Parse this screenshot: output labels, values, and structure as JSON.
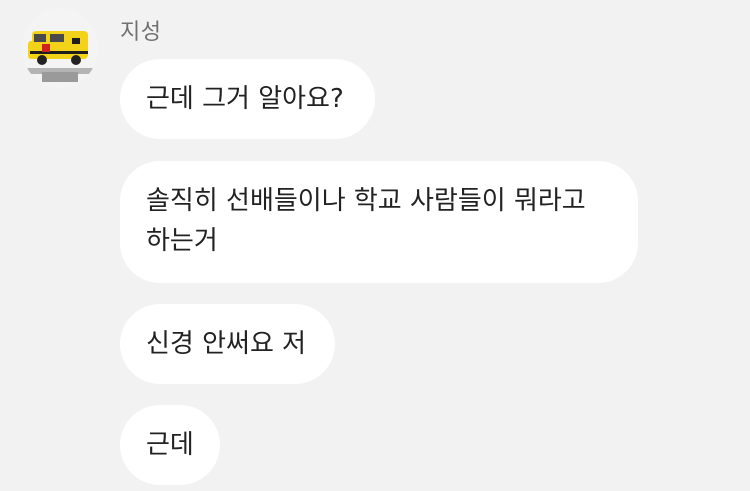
{
  "chat": {
    "sender_name": "지성",
    "avatar_icon": "ambulance-toy-icon",
    "messages": [
      {
        "text": "근데 그거 알아요?"
      },
      {
        "text": "솔직히 선배들이나 학교 사람들이 뭐라고 하는거"
      },
      {
        "text": "신경 안써요 저"
      },
      {
        "text": "근데"
      }
    ]
  }
}
